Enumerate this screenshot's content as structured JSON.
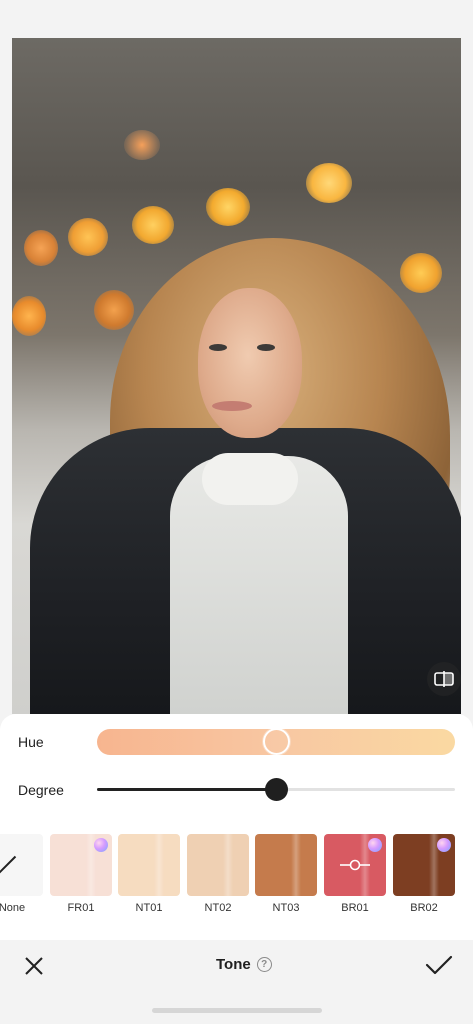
{
  "controls": {
    "hue_label": "Hue",
    "degree_label": "Degree",
    "hue_value": 0.5,
    "degree_value": 0.5
  },
  "presets": [
    {
      "label": "None",
      "color": "#f6f6f6",
      "premium": false
    },
    {
      "label": "FR01",
      "color": "#f7e0d6",
      "premium": true
    },
    {
      "label": "NT01",
      "color": "#f6dcc0",
      "premium": false
    },
    {
      "label": "NT02",
      "color": "#efd0b3",
      "premium": false
    },
    {
      "label": "NT03",
      "color": "#c57b4c",
      "premium": false
    },
    {
      "label": "BR01",
      "color": "#d85a62",
      "premium": true,
      "selected": true
    },
    {
      "label": "BR02",
      "color": "#7d3e22",
      "premium": true
    }
  ],
  "bottom_bar": {
    "title": "Tone",
    "help_glyph": "?"
  },
  "icons": {
    "compare": "compare-icon",
    "close": "close-icon",
    "confirm": "check-icon",
    "help": "help-icon",
    "premium": "gem-icon"
  }
}
